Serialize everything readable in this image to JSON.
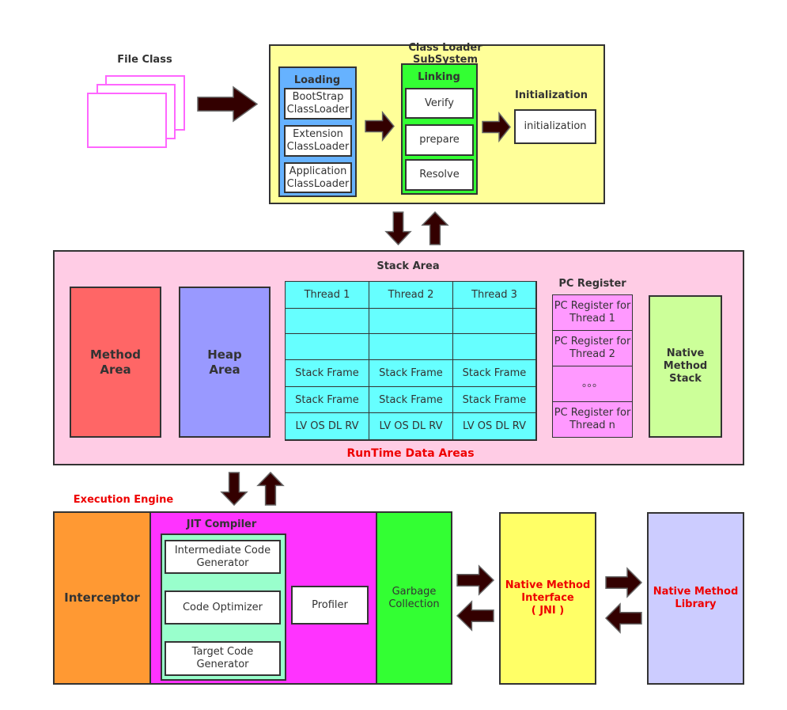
{
  "file_class": {
    "label": "File Class"
  },
  "class_loader": {
    "title_line1": "Class Loader",
    "title_line2": "SubSystem",
    "loading": {
      "label": "Loading",
      "items": [
        [
          "BootStrap",
          "ClassLoader"
        ],
        [
          "Extension",
          "ClassLoader"
        ],
        [
          "Application",
          "ClassLoader"
        ]
      ]
    },
    "linking": {
      "label": "Linking",
      "items": [
        "Verify",
        "prepare",
        "Resolve"
      ]
    },
    "initialization": {
      "label": "Initialization",
      "box": "initialization"
    }
  },
  "runtime": {
    "label": "RunTime Data Areas",
    "method_area": [
      "Method",
      "Area"
    ],
    "heap_area": [
      "Heap",
      "Area"
    ],
    "stack_area": {
      "label": "Stack Area",
      "headers": [
        "Thread 1",
        "Thread 2",
        "Thread 3"
      ],
      "rows": [
        [
          "",
          "",
          ""
        ],
        [
          "",
          "",
          ""
        ],
        [
          "Stack  Frame",
          "Stack  Frame",
          "Stack  Frame"
        ],
        [
          "Stack  Frame",
          "Stack  Frame",
          "Stack  Frame"
        ],
        [
          "LV OS DL RV",
          "LV OS DL RV",
          "LV OS DL RV"
        ]
      ]
    },
    "pc_register": {
      "label": "PC Register",
      "items": [
        [
          "PC Register for",
          "Thread 1"
        ],
        [
          "PC Register for",
          "Thread 2"
        ],
        [
          "。。。",
          ""
        ],
        [
          "PC Register for",
          "Thread n"
        ]
      ]
    },
    "native_method_stack": [
      "Native",
      "Method",
      "Stack"
    ]
  },
  "execution_engine": {
    "label": "Execution Engine",
    "interceptor": "Interceptor",
    "jit": {
      "label": "JIT  Compiler",
      "items": [
        [
          "Intermediate Code",
          "Generator"
        ],
        [
          "Code Optimizer",
          ""
        ],
        [
          "Target Code",
          "Generator"
        ]
      ],
      "profiler": "Profiler"
    },
    "gc": [
      "Garbage",
      "Collection"
    ]
  },
  "jni": [
    "Native Method",
    "Interface",
    "( JNI )"
  ],
  "native_library": [
    "Native Method",
    "Library"
  ],
  "colors": {
    "class_loader": "#ffff99",
    "loading": "#66b2ff",
    "linking": "#33ff33",
    "runtime": "#ffcce5",
    "method_area": "#ff6666",
    "heap": "#9999ff",
    "thread": "#66ffff",
    "pc_register": "#ff99ff",
    "native_stack": "#ccff99",
    "interceptor": "#ff9933",
    "jit": "#ff33ff",
    "jit_inner": "#99ffcc",
    "gc": "#33ff33",
    "jni": "#ffff66",
    "library": "#ccccff",
    "arrow": "#330000",
    "red_label": "#ee0000"
  }
}
